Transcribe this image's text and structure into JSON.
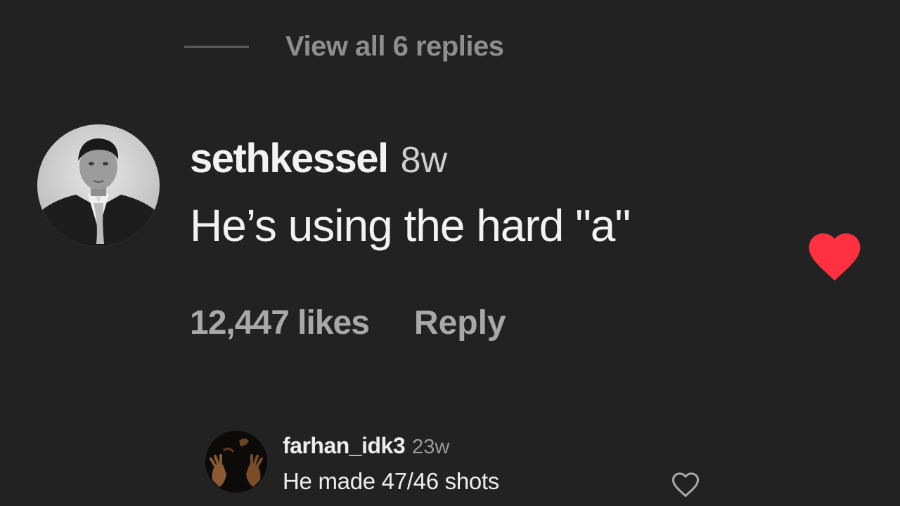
{
  "replies_toggle": {
    "label": "View all 6 replies"
  },
  "comment": {
    "username": "sethkessel",
    "time": "8w",
    "text": "He’s using the hard \"a\"",
    "likes_label": "12,447 likes",
    "reply_label": "Reply",
    "liked": true,
    "heart_color": "#ff3040"
  },
  "reply_comment": {
    "username": "farhan_idk3",
    "time": "23w",
    "text": "He made 47/46 shots",
    "liked": false
  },
  "colors": {
    "background": "#222223",
    "muted_text": "#8e8e8f",
    "like_red": "#ff3040"
  }
}
